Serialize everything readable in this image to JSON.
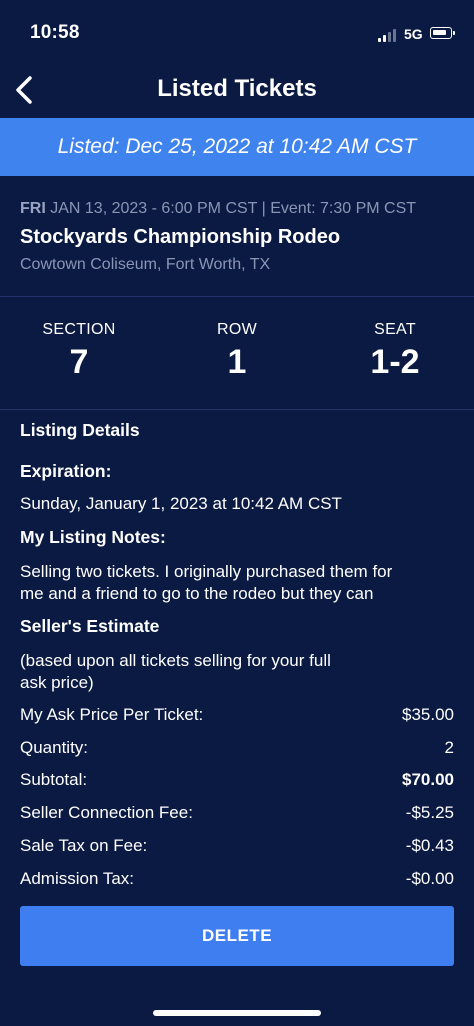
{
  "status_bar": {
    "time": "10:58",
    "network": "5G"
  },
  "nav": {
    "title": "Listed Tickets"
  },
  "banner": {
    "text": "Listed: Dec 25, 2022 at 10:42 AM CST"
  },
  "event": {
    "day": "FRI",
    "date_time": "JAN 13, 2023 -   6:00 PM CST | Event: 7:30 PM CST",
    "name": "Stockyards Championship Rodeo",
    "venue": "Cowtown Coliseum, Fort Worth, TX"
  },
  "seating": {
    "section_label": "SECTION",
    "section_value": "7",
    "row_label": "ROW",
    "row_value": "1",
    "seat_label": "SEAT",
    "seat_value": "1-2"
  },
  "details": {
    "heading": "Listing Details",
    "expiration_label": "Expiration:",
    "expiration_value": "Sunday, January 1, 2023 at 10:42 AM CST",
    "notes_label": "My Listing Notes:",
    "notes_line1": "Selling two tickets. I originally purchased them for",
    "notes_line2": "me and a friend to go to the rodeo but they can",
    "estimate_label": "Seller's Estimate",
    "estimate_note_line1": "(based upon all tickets selling for your full",
    "estimate_note_line2": "ask price)",
    "rows": [
      {
        "label": "My Ask Price Per Ticket:",
        "value": "$35.00"
      },
      {
        "label": "Quantity:",
        "value": "2"
      },
      {
        "label": "Subtotal:",
        "value": "$70.00"
      },
      {
        "label": "Seller Connection Fee:",
        "value": "-$5.25"
      },
      {
        "label": "Sale Tax on Fee:",
        "value": "-$0.43"
      },
      {
        "label": "Admission Tax:",
        "value": "-$0.00"
      }
    ]
  },
  "actions": {
    "delete_label": "DELETE"
  },
  "colors": {
    "background": "#0b1a42",
    "accent": "#3f83ef",
    "muted_text": "#8a96b6"
  },
  "icons": {
    "back": "chevron-left-icon",
    "signal": "signal-bars-icon",
    "battery": "battery-icon"
  }
}
